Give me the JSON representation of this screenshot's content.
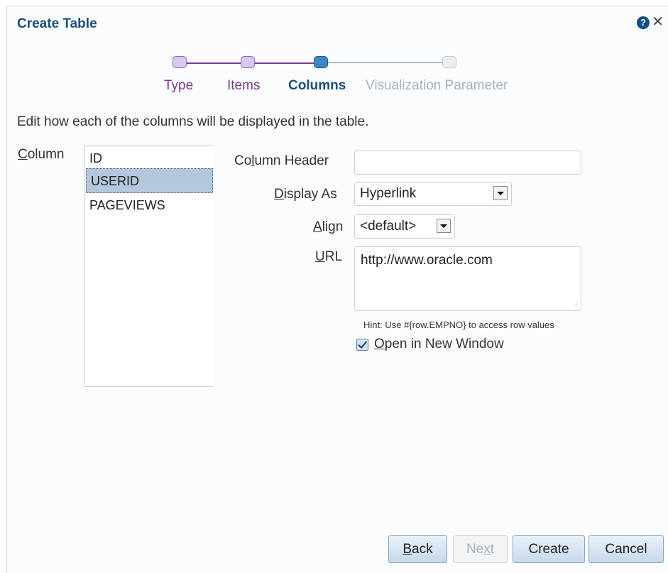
{
  "dialog": {
    "title": "Create Table",
    "help_icon": "question-circle-icon",
    "close_icon": "close-icon",
    "close_glyph": "✕",
    "help_glyph": "?"
  },
  "train": {
    "steps": [
      {
        "label": "Type",
        "state": "visited"
      },
      {
        "label": "Items",
        "state": "visited"
      },
      {
        "label": "Columns",
        "state": "current"
      },
      {
        "label": "Visualization Parameter",
        "state": "future"
      }
    ]
  },
  "instruction": "Edit how each of the columns will be displayed in the table.",
  "column_list": {
    "label_accesskey": "C",
    "label_rest": "olumn",
    "items": [
      "ID",
      "USERID",
      "PAGEVIEWS"
    ],
    "selected": "USERID"
  },
  "form": {
    "column_header": {
      "label_pre": "Co",
      "label_accesskey": "l",
      "label_post": "umn Header",
      "value": ""
    },
    "display_as": {
      "label_accesskey": "D",
      "label_rest": "isplay As",
      "value": "Hyperlink"
    },
    "align": {
      "label_accesskey": "A",
      "label_rest": "lign",
      "value": "<default>"
    },
    "url": {
      "label_accesskey": "U",
      "label_rest": "RL",
      "value": "http://www.oracle.com"
    },
    "hint": "Hint: Use #{row.EMPNO} to access row values",
    "open_new_window": {
      "label_accesskey": "O",
      "label_rest": "pen in New Window",
      "checked": true
    }
  },
  "buttons": {
    "back": {
      "accesskey": "B",
      "rest": "ack",
      "enabled": true
    },
    "next": {
      "pre": "Ne",
      "accesskey": "x",
      "post": "t",
      "enabled": false
    },
    "create": {
      "label": "Create",
      "enabled": true
    },
    "cancel": {
      "label": "Cancel",
      "enabled": true
    }
  },
  "colors": {
    "title": "#1d4e7a",
    "visited_step": "#7c3a90",
    "current_step": "#3f86c4",
    "future_step": "#a8b2bd"
  }
}
